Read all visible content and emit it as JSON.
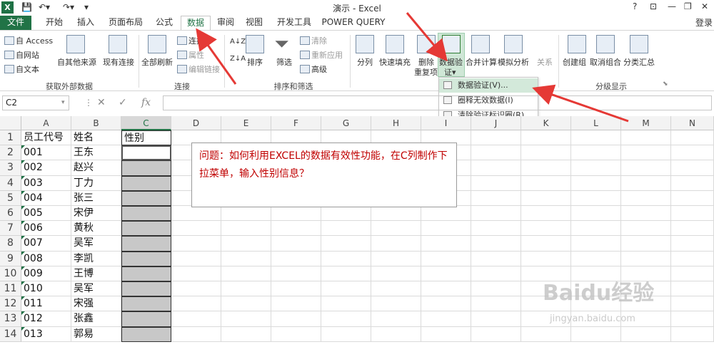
{
  "window": {
    "title": "演示 - Excel",
    "help": "?",
    "login": "登录"
  },
  "tabs": [
    {
      "label": "文件"
    },
    {
      "label": "开始"
    },
    {
      "label": "插入"
    },
    {
      "label": "页面布局"
    },
    {
      "label": "公式"
    },
    {
      "label": "数据",
      "active": true
    },
    {
      "label": "审阅"
    },
    {
      "label": "视图"
    },
    {
      "label": "开发工具"
    },
    {
      "label": "POWER QUERY"
    }
  ],
  "ribbon": {
    "external": {
      "access": "自 Access",
      "web": "自网站",
      "text": "自文本",
      "other": "自其他来源",
      "existing": "现有连接",
      "group": "获取外部数据"
    },
    "connections": {
      "refresh": "全部刷新",
      "conn": "连接",
      "props": "属性",
      "edit": "编辑链接",
      "group": "连接"
    },
    "sort": {
      "sort_btn": "排序",
      "filter": "筛选",
      "clear": "清除",
      "reapply": "重新应用",
      "advanced": "高级",
      "group": "排序和筛选"
    },
    "tools": {
      "split": "分列",
      "flash": "快速填充",
      "remove_l1": "删除",
      "remove_l2": "重复项",
      "validate_l1": "数据验",
      "validate_l2": "证",
      "consolidate": "合并计算",
      "whatif": "模拟分析",
      "relation": "关系"
    },
    "outline": {
      "group_btn": "创建组",
      "ungroup": "取消组合",
      "subtotal": "分类汇总",
      "group": "分级显示"
    }
  },
  "menu": {
    "items": [
      "数据验证(V)...",
      "圈释无效数据(I)",
      "清除验证标识圈(R)"
    ]
  },
  "formula": {
    "namebox": "C2",
    "fx": "fx",
    "content": ""
  },
  "grid": {
    "columns": [
      "A",
      "B",
      "C",
      "D",
      "E",
      "F",
      "G",
      "H",
      "I",
      "J",
      "K",
      "L",
      "M",
      "N"
    ],
    "rows": [
      "1",
      "2",
      "3",
      "4",
      "5",
      "6",
      "7",
      "8",
      "9",
      "10",
      "11",
      "12",
      "13",
      "14"
    ],
    "data": [
      [
        "员工代号",
        "姓名",
        "性别"
      ],
      [
        "001",
        "王东",
        ""
      ],
      [
        "002",
        "赵兴",
        ""
      ],
      [
        "003",
        "丁力",
        ""
      ],
      [
        "004",
        "张三",
        ""
      ],
      [
        "005",
        "宋伊",
        ""
      ],
      [
        "006",
        "黄秋",
        ""
      ],
      [
        "007",
        "吴军",
        ""
      ],
      [
        "008",
        "李凯",
        ""
      ],
      [
        "009",
        "王博",
        ""
      ],
      [
        "010",
        "吴军",
        ""
      ],
      [
        "011",
        "宋强",
        ""
      ],
      [
        "012",
        "张鑫",
        ""
      ],
      [
        "013",
        "郭易",
        ""
      ]
    ]
  },
  "note": "问题：如何利用EXCEL的数据有效性功能，在C列制作下拉菜单，输入性别信息？",
  "watermark": {
    "main": "Baidu经验",
    "sub": "jingyan.baidu.com"
  },
  "colors": {
    "excel_green": "#217346",
    "arrow_red": "#e53935",
    "note_text": "#c00000",
    "selected_fill": "#c8c8c8"
  }
}
